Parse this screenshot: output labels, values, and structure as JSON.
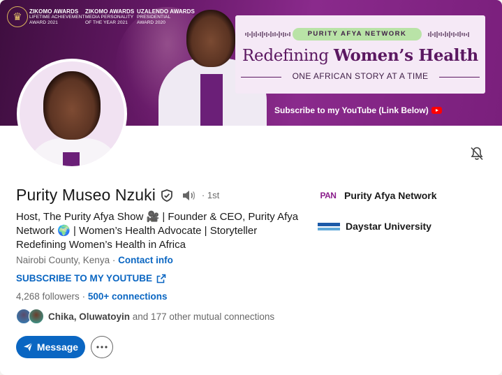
{
  "banner": {
    "awards": [
      {
        "title": "ZIKOMO AWARDS",
        "line1": "LIFETIME ACHIEVEMENT",
        "line2": "AWARD 2021"
      },
      {
        "title": "ZIKOMO AWARDS",
        "line1": "MEDIA PERSONALITY",
        "line2": "OF THE YEAR 2021"
      },
      {
        "title": "UZALENDO AWARDS",
        "line1": "PRESIDENTIAL",
        "line2": "AWARD 2020"
      }
    ],
    "pill": "PURITY AFYA NETWORK",
    "title_part1": "Redefining ",
    "title_part2": "Women’s Health",
    "subtitle": "ONE AFRICAN STORY AT A TIME",
    "subscribe": "Subscribe to my YouTube (Link Below)",
    "accent_color": "#6a1a6b"
  },
  "profile": {
    "name": "Purity Museo Nzuki",
    "degree": "· 1st",
    "headline": "Host, The Purity Afya Show 🎥 | Founder & CEO, Purity Afya Network 🌍 | Women’s Health Advocate | Storyteller Redefining Women’s Health in Africa",
    "location": "Nairobi County, Kenya",
    "location_sep": " · ",
    "contact": "Contact info",
    "external_link": "SUBSCRIBE TO MY YOUTUBE",
    "followers": "4,268 followers",
    "followers_sep": " · ",
    "connections": "500+ connections",
    "mutual_names": "Chika, Oluwatoyin",
    "mutual_rest": " and 177 other mutual connections"
  },
  "orgs": [
    {
      "name": "Purity Afya Network",
      "logo_text": "PAN",
      "icon": "pan-logo"
    },
    {
      "name": "Daystar University",
      "icon": "daystar-logo"
    }
  ],
  "actions": {
    "message": "Message",
    "more_icon": "ellipsis-icon",
    "bell_icon": "bell-off-icon"
  },
  "colors": {
    "primary": "#0a66c2",
    "brand_purple": "#8b1e8c"
  }
}
